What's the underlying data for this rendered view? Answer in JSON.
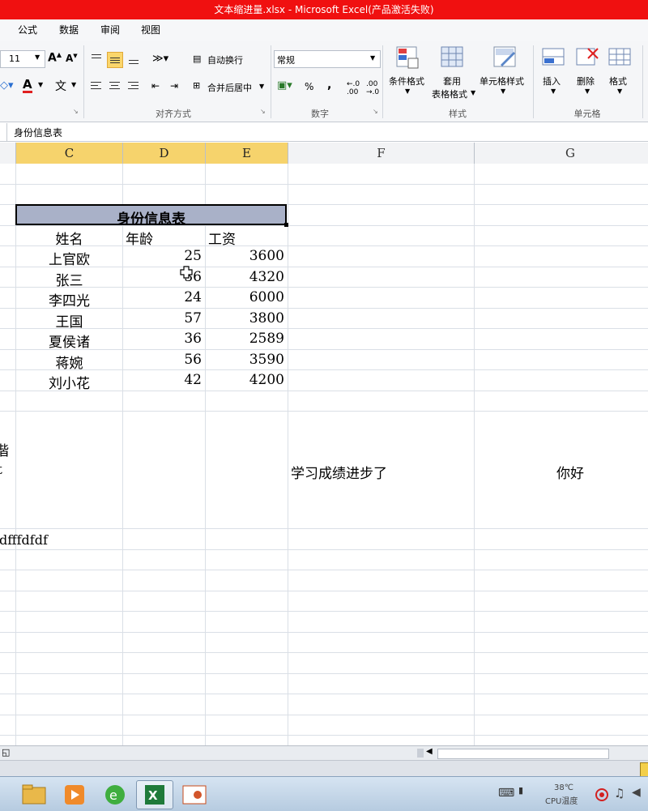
{
  "window": {
    "title": "文本缩进量.xlsx  -  Microsoft Excel(产品激活失败)"
  },
  "menu_tabs": [
    "公式",
    "数据",
    "审阅",
    "视图"
  ],
  "ribbon": {
    "font_size": "11",
    "wrap_text": "自动换行",
    "merge_center": "合并后居中",
    "number_format": "常规",
    "percent": "%",
    "comma": ",",
    "cond_format": "条件格式",
    "table_format_1": "套用",
    "table_format_2": "表格格式",
    "cell_styles": "单元格样式",
    "insert": "插入",
    "delete": "删除",
    "format": "格式",
    "groups": {
      "alignment": "对齐方式",
      "number": "数字",
      "styles": "样式",
      "cells": "单元格"
    }
  },
  "formula_bar": {
    "content": "身份信息表"
  },
  "columns": [
    "C",
    "D",
    "E",
    "F",
    "G"
  ],
  "sheet": {
    "table_title": "身份信息表",
    "headers": [
      "姓名",
      "年龄",
      "工资"
    ],
    "rows": [
      [
        "上官欧",
        "25",
        "3600"
      ],
      [
        "张三",
        "36",
        "4320"
      ],
      [
        "李四光",
        "24",
        "6000"
      ],
      [
        "王国",
        "57",
        "3800"
      ],
      [
        "夏侯诸",
        "36",
        "2589"
      ],
      [
        "蒋婉",
        "56",
        "3590"
      ],
      [
        "刘小花",
        "42",
        "4200"
      ]
    ],
    "f_text": "学习成绩进步了",
    "g_text": "你好",
    "left_text": "dfffdfdf",
    "clipped_glyph_1": "偕",
    "clipped_glyph_2": "t"
  },
  "taskbar": {
    "temp": "38℃",
    "cpu": "CPU温度"
  },
  "colors": {
    "title_bar": "#f01010",
    "selected_header": "#f6d36c",
    "title_cell": "#a9b1c8"
  }
}
